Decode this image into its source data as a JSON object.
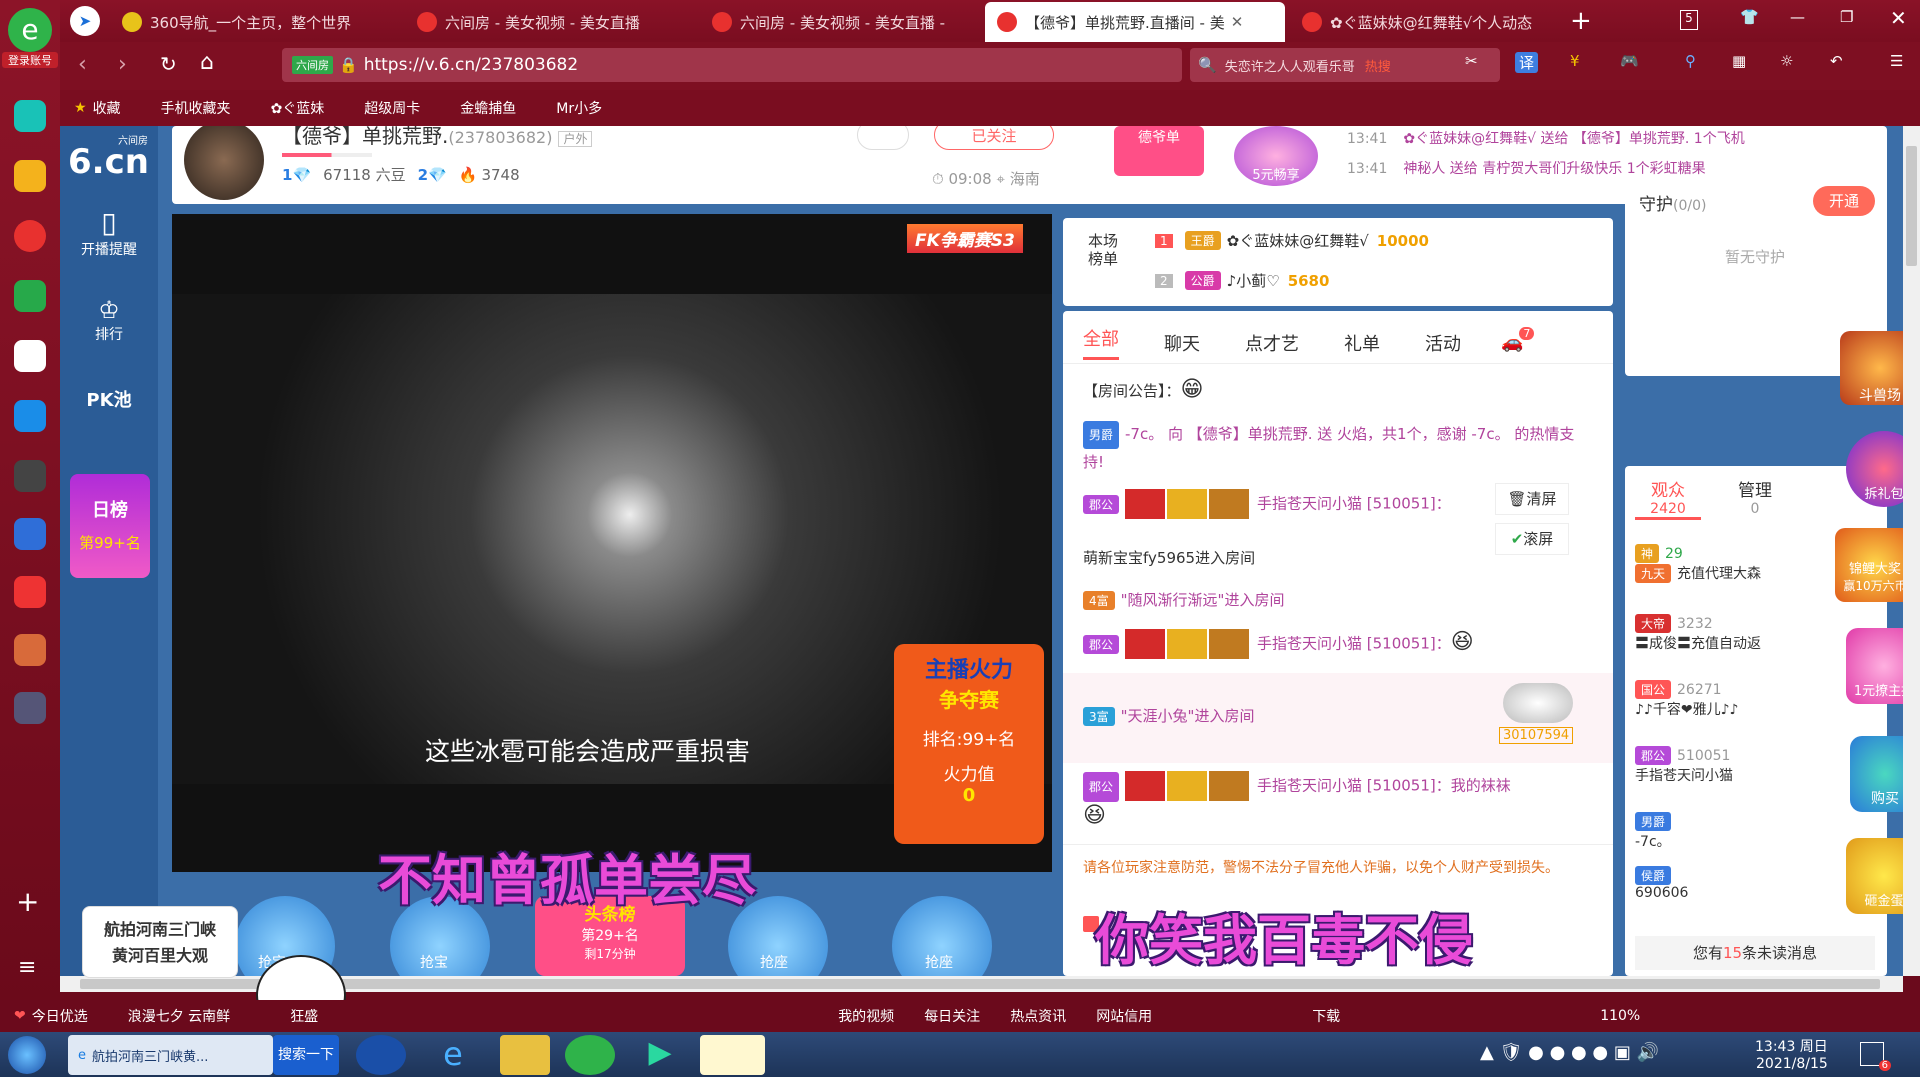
{
  "browser": {
    "login_label": "登录账号",
    "tabs": [
      {
        "label": "360导航_一个主页，整个世界",
        "active": false
      },
      {
        "label": "六间房 - 美女视频 - 美女直播",
        "active": false
      },
      {
        "label": "六间房 - 美女视频 - 美女直播 -",
        "active": false
      },
      {
        "label": "【德爷】单挑荒野.直播间 - 美",
        "active": true
      },
      {
        "label": "✿ぐ蓝妹妹@红舞鞋√个人动态",
        "active": false
      }
    ],
    "tab_count": "5",
    "url": "https://v.6.cn/237803682",
    "site_badge": "六间房",
    "search_placeholder": "失恋许之人人观看乐哥",
    "search_hot": "热搜",
    "translate_label": "译",
    "bookmarks": [
      "收藏",
      "手机收藏夹",
      "✿ぐ蓝妹",
      "超级周卡",
      "金蟾捕鱼",
      "Mr小多"
    ]
  },
  "sidebar": {
    "logo_top": "六间房",
    "logo_main": "6.cn",
    "items": [
      {
        "label": "开播提醒",
        "icon": "phone-icon"
      },
      {
        "label": "排行",
        "icon": "crown-icon"
      },
      {
        "label": "PK池",
        "icon": "pk-icon"
      }
    ],
    "daily_rank_title": "日榜",
    "daily_rank_value": "第99+名"
  },
  "header": {
    "streamer_name": "【德爷】单挑荒野.",
    "room_id": "(237803682)",
    "tag": "户外",
    "level": "1",
    "beans": "67118 六豆",
    "fans_level": "2",
    "heat": "3748",
    "follow_label": "已关注",
    "time": "09:08",
    "location": "海南",
    "promo1": "德爷单",
    "promo2": "5元畅享",
    "gift_feed": [
      {
        "time": "13:41",
        "text": "✿ぐ蓝妹妹@红舞鞋√ 送给 【德爷】单挑荒野. 1个飞机"
      },
      {
        "time": "13:41",
        "text": "神秘人 送给 青柠贺大哥们升级快乐 1个彩虹糖果"
      }
    ]
  },
  "video": {
    "badge": "FK争霸赛S3",
    "subtitle": "这些冰雹可能会造成严重损害",
    "overlay_lyric": "不知曾孤单尝尽",
    "firepower_title_1": "主播火力",
    "firepower_title_2": "争夺赛",
    "rank_label": "排名:99+名",
    "fire_label": "火力值",
    "fire_value": "0",
    "seats": [
      "抢宝",
      "抢宝",
      "抢座",
      "抢座"
    ],
    "headline_label": "头条榜",
    "headline_rank": "第29+名",
    "headline_sub": "剩17分钟"
  },
  "ranking": {
    "title": "本场榜单",
    "rows": [
      {
        "rank": "1",
        "badge": "王爵",
        "name": "✿ぐ蓝妹妹@红舞鞋√",
        "score": "10000"
      },
      {
        "rank": "2",
        "badge": "公爵",
        "name": "♪小蓟♡",
        "score": "5680"
      }
    ]
  },
  "chat": {
    "tabs": [
      "全部",
      "聊天",
      "点才艺",
      "礼单",
      "活动"
    ],
    "car_badge": "7",
    "notice_label": "【房间公告】：",
    "clear_label": "清屏",
    "scroll_label": "滚屏",
    "messages": [
      {
        "badge": "男爵",
        "text": "-7c。 向 【德爷】单挑荒野. 送 火焰，共1个，感谢 -7c。 的热情支持!"
      },
      {
        "badge": "郡公",
        "text": "手指苍天问小猫 [510051]："
      },
      {
        "badge": "",
        "text": "萌新宝宝fy5965进入房间"
      },
      {
        "badge": "4富",
        "text": "\"随风渐行渐远\"进入房间"
      },
      {
        "badge": "郡公",
        "text": "手指苍天问小猫 [510051]："
      },
      {
        "badge": "3富",
        "text": "\"天涯小兔\"进入房间"
      },
      {
        "badge": "郡公",
        "text": "手指苍天问小猫 [510051]：我的袜袜"
      }
    ],
    "car_number": "30107594",
    "warning": "请各位玩家注意防范，警惕不法分子冒充他人诈骗，以免个人财产受到损失。",
    "overlay_lyric": "你笑我百毒不侵"
  },
  "guard": {
    "title": "守护",
    "count": "(0/0)",
    "open_label": "开通",
    "empty_label": "暂无守护"
  },
  "audience": {
    "tab_audience": "观众",
    "audience_count": "2420",
    "tab_manage": "管理",
    "manage_count": "0",
    "users": [
      {
        "badge": "神",
        "sub": "九天",
        "name": "充值代理大森",
        "id": "29"
      },
      {
        "badge": "大帝",
        "name": "〓成俊〓充值自动返",
        "id": "3232"
      },
      {
        "badge": "国公",
        "name": "♪♪千容❤雅儿♪♪",
        "id": "26271"
      },
      {
        "badge": "郡公",
        "name": "手指苍天问小猫",
        "id": "510051"
      },
      {
        "badge": "男爵",
        "name": "-7c。",
        "id": ""
      },
      {
        "badge": "侯爵",
        "name": "",
        "id": "690606"
      }
    ],
    "unread_prefix": "您有",
    "unread_count": "15",
    "unread_suffix": "条未读消息"
  },
  "promos": [
    "斗兽场",
    "拆礼包",
    "锦鲤大奖",
    "赢10万六币",
    "1元撩主播",
    "购买",
    "砸金蛋"
  ],
  "floating_card": {
    "line1": "航拍河南三门峡",
    "line2": "黄河百里大观"
  },
  "statusbar": {
    "items": [
      "今日优选",
      "浪漫七夕 云南鲜",
      "狂盛"
    ],
    "right_items": [
      "我的视频",
      "每日关注",
      "热点资讯",
      "网站信用",
      "下载"
    ],
    "zoom": "110%"
  },
  "taskbar": {
    "ie_window_label": "航拍河南三门峡黄...",
    "search_label": "搜索一下",
    "time": "13:43 周日",
    "date": "2021/8/15",
    "notif_count": "6"
  }
}
